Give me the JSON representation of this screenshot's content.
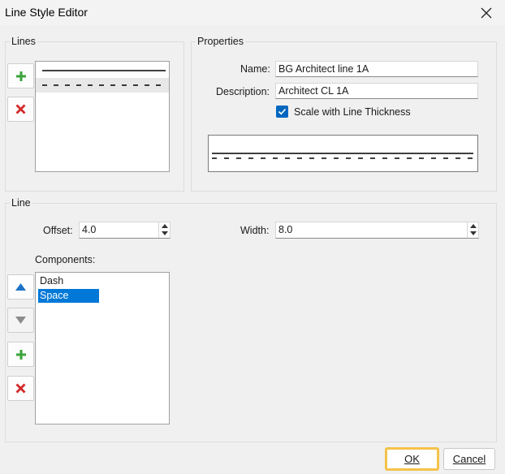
{
  "window": {
    "title": "Line Style Editor"
  },
  "lines_group": {
    "label": "Lines",
    "items": [
      {
        "style": "solid"
      },
      {
        "style": "dashed",
        "selected": true
      }
    ]
  },
  "properties_group": {
    "label": "Properties",
    "name_label": "Name:",
    "name_value": "BG Architect line 1A",
    "description_label": "Description:",
    "description_value": "Architect CL 1A",
    "scale_checkbox_label": "Scale with Line Thickness",
    "scale_checked": true
  },
  "line_group": {
    "label": "Line",
    "offset_label": "Offset:",
    "offset_value": "4.0",
    "width_label": "Width:",
    "width_value": "8.0",
    "components_label": "Components:",
    "components": [
      {
        "label": "Dash",
        "selected": false
      },
      {
        "label": "Space",
        "selected": true
      }
    ]
  },
  "buttons": {
    "ok": "OK",
    "cancel": "Cancel"
  },
  "colors": {
    "accent": "#0078d7",
    "add_green": "#3aa33a",
    "delete_red": "#d32a2a",
    "default_button_border": "#f3c34a"
  }
}
